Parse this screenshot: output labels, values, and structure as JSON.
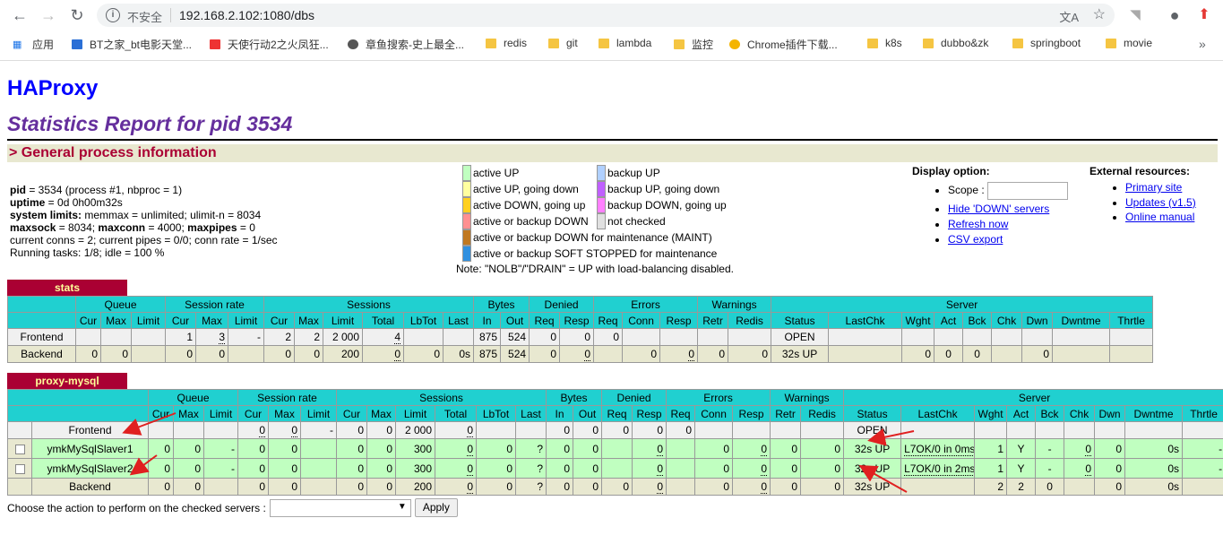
{
  "browser": {
    "insecure_label": "不安全",
    "url": "192.168.2.102:1080/dbs",
    "bookmarks": [
      {
        "label": "应用"
      },
      {
        "label": "BT之家_bt电影天堂..."
      },
      {
        "label": "天使行动2之火凤狂..."
      },
      {
        "label": "章鱼搜索-史上最全..."
      },
      {
        "label": "redis"
      },
      {
        "label": "git"
      },
      {
        "label": "lambda"
      },
      {
        "label": "监控"
      },
      {
        "label": "Chrome插件下载..."
      },
      {
        "label": "k8s"
      },
      {
        "label": "dubbo&zk"
      },
      {
        "label": "springboot"
      },
      {
        "label": "movie"
      }
    ]
  },
  "page": {
    "title": "HAProxy",
    "subtitle": "Statistics Report for pid 3534",
    "section_title": "> General process information",
    "process": {
      "line1_label": "pid",
      "line1_value": " = 3534 (process #1, nbproc = 1)",
      "line2_label": "uptime",
      "line2_value": " = 0d 0h00m32s",
      "line3_label": "system limits:",
      "line3_value": " memmax = unlimited; ulimit-n = 8034",
      "line4_label": "maxsock",
      "line4_value": " = 8034; ",
      "line4b_label": "maxconn",
      "line4b_value": " = 4000; ",
      "line4c_label": "maxpipes",
      "line4c_value": " = 0",
      "line5": "current conns = 2; current pipes = 0/0; conn rate = 1/sec",
      "line6": "Running tasks: 1/8; idle = 100 %"
    },
    "legend": {
      "items": [
        {
          "label": "active UP",
          "color": "#c0ffc0"
        },
        {
          "label": "active UP, going down",
          "color": "#ffffa0"
        },
        {
          "label": "active DOWN, going up",
          "color": "#ffd020"
        },
        {
          "label": "active or backup DOWN",
          "color": "#ff9090"
        },
        {
          "label": "active or backup DOWN for maintenance (MAINT)",
          "color": "#c07820"
        },
        {
          "label": "active or backup SOFT STOPPED for maintenance",
          "color": "#3090e0"
        },
        {
          "label": "backup UP",
          "color": "#b0d0ff"
        },
        {
          "label": "backup UP, going down",
          "color": "#c060ff"
        },
        {
          "label": "backup DOWN, going up",
          "color": "#ff80ff"
        },
        {
          "label": "not checked",
          "color": "#e0e0e0"
        }
      ],
      "note": "Note: \"NOLB\"/\"DRAIN\" = UP with load-balancing disabled."
    },
    "display_option": {
      "title": "Display option:",
      "scope_label": "Scope :",
      "links": [
        "Hide 'DOWN' servers",
        "Refresh now",
        "CSV export"
      ]
    },
    "external_resources": {
      "title": "External resources:",
      "links": [
        "Primary site",
        "Updates (v1.5)",
        "Online manual"
      ]
    }
  },
  "headers": {
    "groups": [
      "Queue",
      "Session rate",
      "Sessions",
      "Bytes",
      "Denied",
      "Errors",
      "Warnings",
      "Server"
    ],
    "cols": [
      "Cur",
      "Max",
      "Limit",
      "Cur",
      "Max",
      "Limit",
      "Cur",
      "Max",
      "Limit",
      "Total",
      "LbTot",
      "Last",
      "In",
      "Out",
      "Req",
      "Resp",
      "Req",
      "Conn",
      "Resp",
      "Retr",
      "Redis",
      "Status",
      "LastChk",
      "Wght",
      "Act",
      "Bck",
      "Chk",
      "Dwn",
      "Dwntme",
      "Thrtle"
    ]
  },
  "stats": {
    "name": "stats",
    "rows": [
      {
        "type": "frontend",
        "name": "Frontend",
        "cells": [
          "",
          "",
          "",
          "1",
          "3",
          "-",
          "2",
          "2",
          "2 000",
          "4",
          "",
          "",
          "875",
          "524",
          "0",
          "0",
          "0",
          "",
          "",
          "",
          "",
          "OPEN",
          "",
          "",
          "",
          "",
          "",
          "",
          "",
          ""
        ]
      },
      {
        "type": "backend",
        "name": "Backend",
        "cells": [
          "0",
          "0",
          "",
          "0",
          "0",
          "",
          "0",
          "0",
          "200",
          "0",
          "0",
          "0s",
          "875",
          "524",
          "0",
          "0",
          "",
          "0",
          "0",
          "0",
          "0",
          "32s UP",
          "",
          "0",
          "0",
          "0",
          "",
          "0",
          "",
          ""
        ]
      }
    ]
  },
  "proxy": {
    "name": "proxy-mysql",
    "rows": [
      {
        "type": "frontend",
        "name": "Frontend",
        "cells": [
          "",
          "",
          "",
          "0",
          "0",
          "-",
          "0",
          "0",
          "2 000",
          "0",
          "",
          "",
          "0",
          "0",
          "0",
          "0",
          "0",
          "",
          "",
          "",
          "",
          "OPEN",
          "",
          "",
          "",
          "",
          "",
          "",
          "",
          ""
        ]
      },
      {
        "type": "up",
        "name": "ymkMySqlSlaver1",
        "cells": [
          "0",
          "0",
          "-",
          "0",
          "0",
          "",
          "0",
          "0",
          "300",
          "0",
          "0",
          "?",
          "0",
          "0",
          "",
          "0",
          "",
          "0",
          "0",
          "0",
          "0",
          "32s UP",
          "L7OK/0 in 0ms",
          "1",
          "Y",
          "-",
          "0",
          "0",
          "0s",
          "-"
        ]
      },
      {
        "type": "up",
        "name": "ymkMySqlSlaver2",
        "cells": [
          "0",
          "0",
          "-",
          "0",
          "0",
          "",
          "0",
          "0",
          "300",
          "0",
          "0",
          "?",
          "0",
          "0",
          "",
          "0",
          "",
          "0",
          "0",
          "0",
          "0",
          "32s UP",
          "L7OK/0 in 2ms",
          "1",
          "Y",
          "-",
          "0",
          "0",
          "0s",
          "-"
        ]
      },
      {
        "type": "backend",
        "name": "Backend",
        "cells": [
          "0",
          "0",
          "",
          "0",
          "0",
          "",
          "0",
          "0",
          "200",
          "0",
          "0",
          "?",
          "0",
          "0",
          "0",
          "0",
          "",
          "0",
          "0",
          "0",
          "0",
          "32s UP",
          "",
          "2",
          "2",
          "0",
          "",
          "0",
          "0s",
          ""
        ]
      }
    ]
  },
  "action": {
    "label": "Choose the action to perform on the checked servers :",
    "apply": "Apply"
  }
}
